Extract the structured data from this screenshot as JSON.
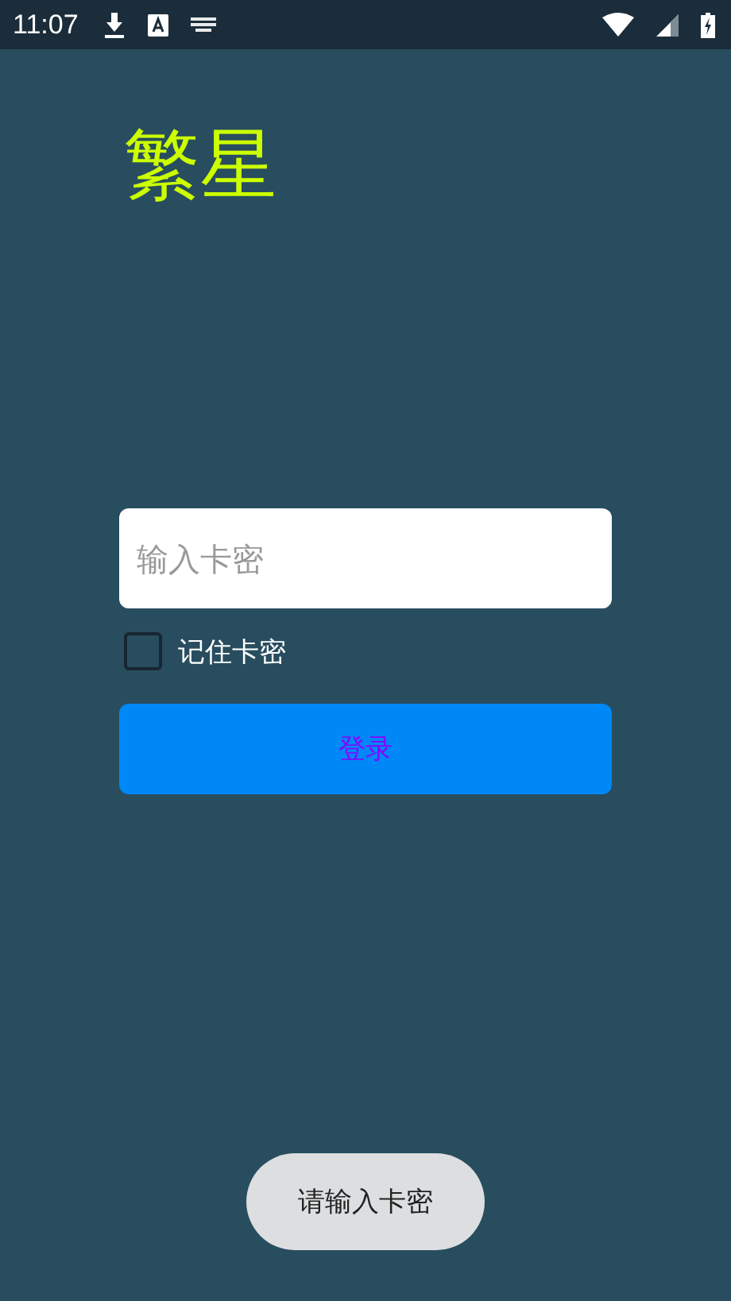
{
  "status_bar": {
    "time": "11:07"
  },
  "title": "繁星",
  "card_field": {
    "placeholder": "输入卡密"
  },
  "remember": {
    "label": "记住卡密",
    "checked": false
  },
  "login_button": {
    "label": "登录"
  },
  "toast": {
    "text": "请输入卡密"
  }
}
